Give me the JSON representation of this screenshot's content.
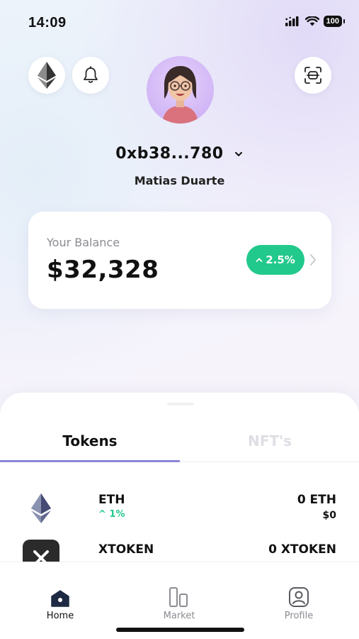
{
  "status_bar": {
    "time": "14:09",
    "battery": "100"
  },
  "header": {
    "address": "0xb38...780",
    "name": "Matias Duarte"
  },
  "balance": {
    "label": "Your Balance",
    "value": "$32,328",
    "change": "2.5%"
  },
  "tabs": [
    {
      "label": "Tokens"
    },
    {
      "label": "NFT's"
    }
  ],
  "tokens": [
    {
      "symbol": "ETH",
      "change": "1%",
      "amount": "0 ETH",
      "fiat": "$0"
    },
    {
      "symbol": "XTOKEN",
      "amount": "0 XTOKEN"
    }
  ],
  "nav": [
    {
      "label": "Home"
    },
    {
      "label": "Market"
    },
    {
      "label": "Profile"
    }
  ],
  "colors": {
    "accent_green": "#22c98c",
    "tab_underline": "#8a87d6",
    "avatar_bg": "#c8a9f3"
  }
}
